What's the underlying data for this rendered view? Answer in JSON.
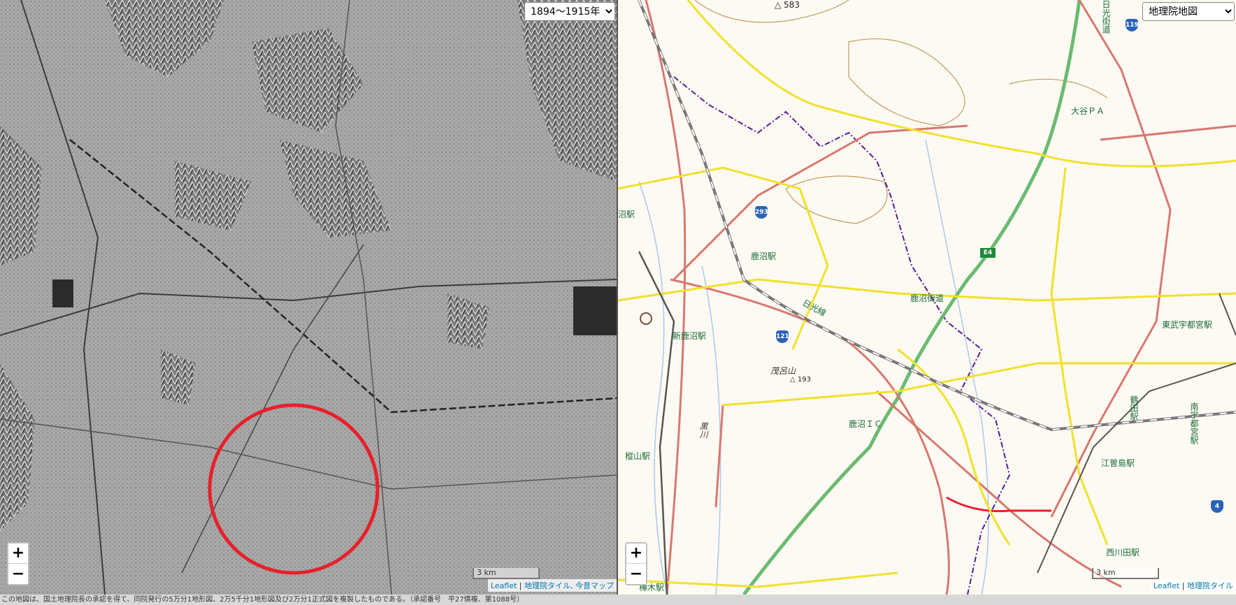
{
  "left_map": {
    "era_select": {
      "selected": "1894〜1915年",
      "options": [
        "1894〜1915年"
      ]
    },
    "zoom_in": "+",
    "zoom_out": "−",
    "scale_label": "3 km",
    "attribution": {
      "leaflet": "Leaflet",
      "sep": " | ",
      "tiles": "地理院タイル, 今昔マップ"
    },
    "highlight_color": "#e8202a"
  },
  "right_map": {
    "layer_select": {
      "selected": "地理院地図",
      "options": [
        "地理院地図"
      ]
    },
    "zoom_in": "+",
    "zoom_out": "−",
    "scale_label": "3 km",
    "attribution": {
      "leaflet": "Leaflet",
      "sep": " | ",
      "tiles": "地理院タイル"
    },
    "labels": {
      "kanuma_sta": "鹿沼駅",
      "shin_kanuma_sta": "新鹿沼駅",
      "nikko_line": "日光線",
      "kanuma_kaido": "鹿沼街道",
      "nikko_kaido": "日光街道",
      "oya_pa": "大谷ＰＡ",
      "kanuma_ic": "鹿沼ＩＣ",
      "moroyama": "茂呂山",
      "moroyama_elev": "△ 193",
      "peak_583": "△ 583",
      "higashi_bu_utsunomiya": "東武宇都宮駅",
      "tsuruta_sta": "鶴田駅",
      "minami_utsunomiya": "南宇都宮駅",
      "esojima_sta": "江曽島駅",
      "nishikawada_sta": "西川田駅",
      "kashiyama_sta": "樅山駅",
      "numa_sta_partial": "沼駅",
      "kurokawa": "黒川",
      "bottom_station": "樺木駅"
    },
    "route_shields": [
      "293",
      "121",
      "119",
      "4",
      "E4"
    ]
  },
  "footer_text": "この地図は、国土地理院長の承認を得て、同院発行の5万分1地形図、2万5千分1地形図及び2万分1正式図を複製したものである。（承認番号　平27情複、第1088号）"
}
